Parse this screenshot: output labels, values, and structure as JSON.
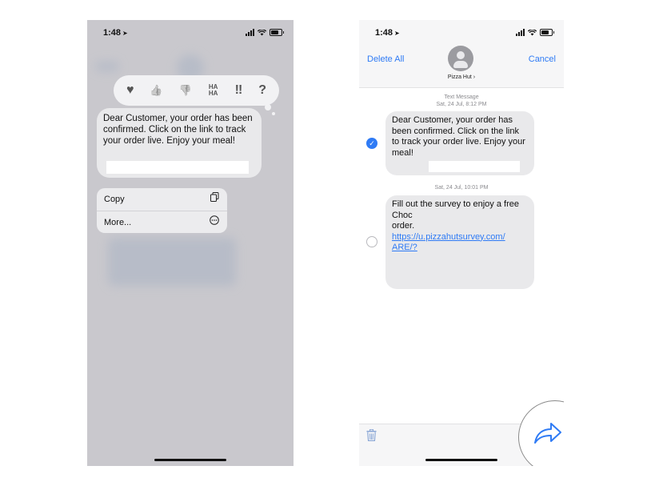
{
  "left": {
    "status_time": "1:48",
    "tapbacks": [
      "♥",
      "👍",
      "👎",
      "HA HA",
      "‼",
      "?"
    ],
    "message": "Dear Customer, your order has been confirmed. Click on the link to track your order live. Enjoy your meal!",
    "menu": [
      {
        "label": "Copy",
        "icon": "copy-icon"
      },
      {
        "label": "More...",
        "icon": "ellipsis-circle-icon"
      }
    ]
  },
  "right": {
    "status_time": "1:48",
    "delete_all": "Delete All",
    "cancel": "Cancel",
    "contact_name": "Pizza Hut",
    "meta1_kind": "Text Message",
    "meta1_date": "Sat, 24 Jul, 8:12 PM",
    "message1": "Dear Customer, your order has been confirmed. Click on the link to track your order live. Enjoy your meal!",
    "meta2_date": "Sat, 24 Jul, 10:01 PM",
    "message2_line1": "Fill out the survey to enjoy a free",
    "message2_line2": "Choc",
    "message2_line3": "order.",
    "message2_link1": "https://u.pizzahutsurvey.com/",
    "message2_link2": "ARE/?"
  },
  "colors": {
    "accent": "#2f7bf5",
    "bubble": "#e9e9eb",
    "left_bg": "#c9c8cd"
  }
}
